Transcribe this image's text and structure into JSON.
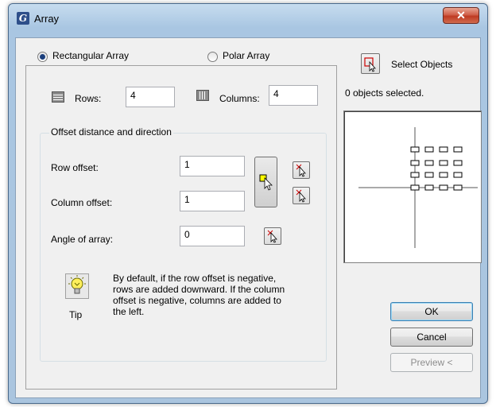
{
  "window": {
    "title": "Array",
    "close_glyph": "✕"
  },
  "mode": {
    "rectangular_label": "Rectangular Array",
    "polar_label": "Polar Array",
    "selected": "rectangular"
  },
  "grid": {
    "rows_label": "Rows:",
    "rows_value": "4",
    "columns_label": "Columns:",
    "columns_value": "4"
  },
  "offset_group": {
    "title": "Offset distance and direction",
    "row_offset_label": "Row offset:",
    "row_offset_value": "1",
    "column_offset_label": "Column offset:",
    "column_offset_value": "1",
    "angle_label": "Angle of array:",
    "angle_value": "0"
  },
  "tip": {
    "label": "Tip",
    "text_lines": [
      "By default, if the row offset is negative,",
      "rows are added downward.  If the column",
      "offset is negative, columns are added to",
      "the left."
    ]
  },
  "selection": {
    "button_label": "Select Objects",
    "status": "0 objects selected."
  },
  "buttons": {
    "ok": "OK",
    "cancel": "Cancel",
    "preview": "Preview <"
  },
  "colors": {
    "title_bar": "#b9d1ea",
    "close": "#c7432b",
    "default_border": "#3c7fb1"
  },
  "icons": [
    "array-app-icon",
    "rows-icon",
    "columns-icon",
    "pick-point-icon",
    "pick-both-icon",
    "tip-bulb-icon",
    "select-objects-icon"
  ]
}
